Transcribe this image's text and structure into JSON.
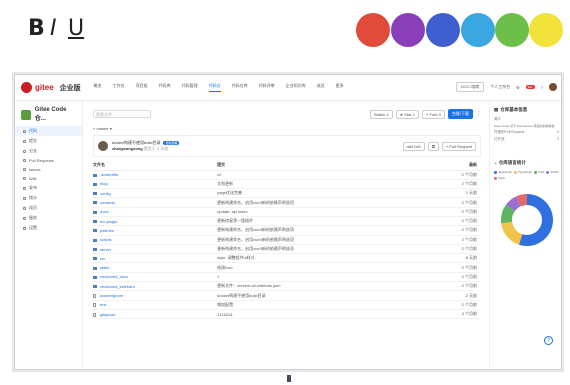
{
  "format_toolbar": {
    "bold": "B",
    "italic": "I",
    "underline": "U",
    "dots": [
      "#e04b3a",
      "#8a3fb8",
      "#3f5fd0",
      "#3aa7e0",
      "#6cc04a",
      "#f2e33b"
    ]
  },
  "nav": {
    "brand": "gitee",
    "brand2": "企业版",
    "items": [
      "概览",
      "工作台",
      "项目组",
      "代码库",
      "代码管理",
      "代码仓",
      "代码仓库",
      "代码评审",
      "企业知识库",
      "成员",
      "更多"
    ],
    "active_index": 5,
    "right": {
      "org": "DCC-电商",
      "workbench": "个人工作台",
      "badge": "99+"
    }
  },
  "sidebar": {
    "repo": "Gitee Code 仓...",
    "items": [
      "代码",
      "提交",
      "分支",
      "Pull Requests",
      "Issues",
      "Wiki",
      "发布",
      "统计",
      "成员",
      "服务",
      "设置"
    ],
    "issues_count": "0"
  },
  "toolbar": {
    "search_placeholder": "搜索文件",
    "watch": "Watch",
    "watch_count": "4",
    "star": "Star",
    "star_count": "1",
    "fork": "Fork",
    "fork_count": "0",
    "clone": "克隆/下载",
    "branch": "master"
  },
  "commit": {
    "message": "docker构建不使用build目录",
    "tag": "更新部署",
    "author": "zhangsongsong",
    "time": "提交于 2 天前",
    "hash": "d8d7af1",
    "pr": "+ Pull Request"
  },
  "table": {
    "headers": [
      "文件名",
      "提交",
      "最新"
    ],
    "rows": [
      {
        "name": ".dockerfile",
        "msg": "v2",
        "time": "2 个月前",
        "dir": true
      },
      {
        "name": "blog",
        "msg": "文档更新",
        "time": "2 个月前",
        "dir": true
      },
      {
        "name": "config",
        "msg": "page优化完善",
        "time": "2 天前",
        "dir": true
      },
      {
        "name": "contacts",
        "msg": "更新构建命名，启用vue3新的依赖声明选项",
        "time": "2 个月前",
        "dir": true
      },
      {
        "name": "docs",
        "msg": "update: api index",
        "time": "2 个月前",
        "dir": true
      },
      {
        "name": "mc-plugin",
        "msg": "更新修复第一版插件",
        "time": "2 个月前",
        "dir": true
      },
      {
        "name": "patches",
        "msg": "更新构建命名，启用vue3新的依赖声明选项",
        "time": "2 个月前",
        "dir": true
      },
      {
        "name": "scripts",
        "msg": "更新构建命名，启用vue3新的依赖声明选项",
        "time": "2 个月前",
        "dir": true
      },
      {
        "name": "server",
        "msg": "更新构建命名，启用vue3新的依赖声明选项",
        "time": "2 个月前",
        "dir": true
      },
      {
        "name": "src",
        "msg": "style: 调整组件ui样式",
        "time": "8 天前",
        "dir": true
      },
      {
        "name": "static",
        "msg": "修改icon",
        "time": "2 个月前",
        "dir": true
      },
      {
        "name": "versioned_docs",
        "msg": "1",
        "time": "2 个月前",
        "dir": true
      },
      {
        "name": "versioned_sidebars",
        "msg": "更新文件：version-v8-sidebars.json",
        "time": "2 个月前",
        "dir": true
      },
      {
        "name": ".dockerignore",
        "msg": "docker构建不使用build目录",
        "time": "2 天前",
        "dir": false
      },
      {
        "name": ".env",
        "msg": "增加配置",
        "time": "2 个月前",
        "dir": false
      },
      {
        "name": ".gitignore",
        "msg": "11111111",
        "time": "3 个月前",
        "dir": false
      }
    ]
  },
  "panel": {
    "title": "仓库基本信息",
    "line1": "简介",
    "line2": "Gitee Code 基于 Docusaurus 搭建的前端模板",
    "pr_label": "开源的Pull Request",
    "issues_label": "已开放",
    "lang_title": "仓库语言统计",
    "pr_count": "0",
    "issues_count": "3"
  },
  "chart_data": {
    "type": "pie",
    "title": "",
    "categories": [
      "JavaScript",
      "TypeScript",
      "CSS",
      "SCSS",
      "Shell"
    ],
    "values": [
      55,
      18,
      12,
      8,
      7
    ],
    "colors": [
      "#2f6fe0",
      "#f0c34a",
      "#5fb55f",
      "#9a6fd0",
      "#e06a6a"
    ]
  }
}
